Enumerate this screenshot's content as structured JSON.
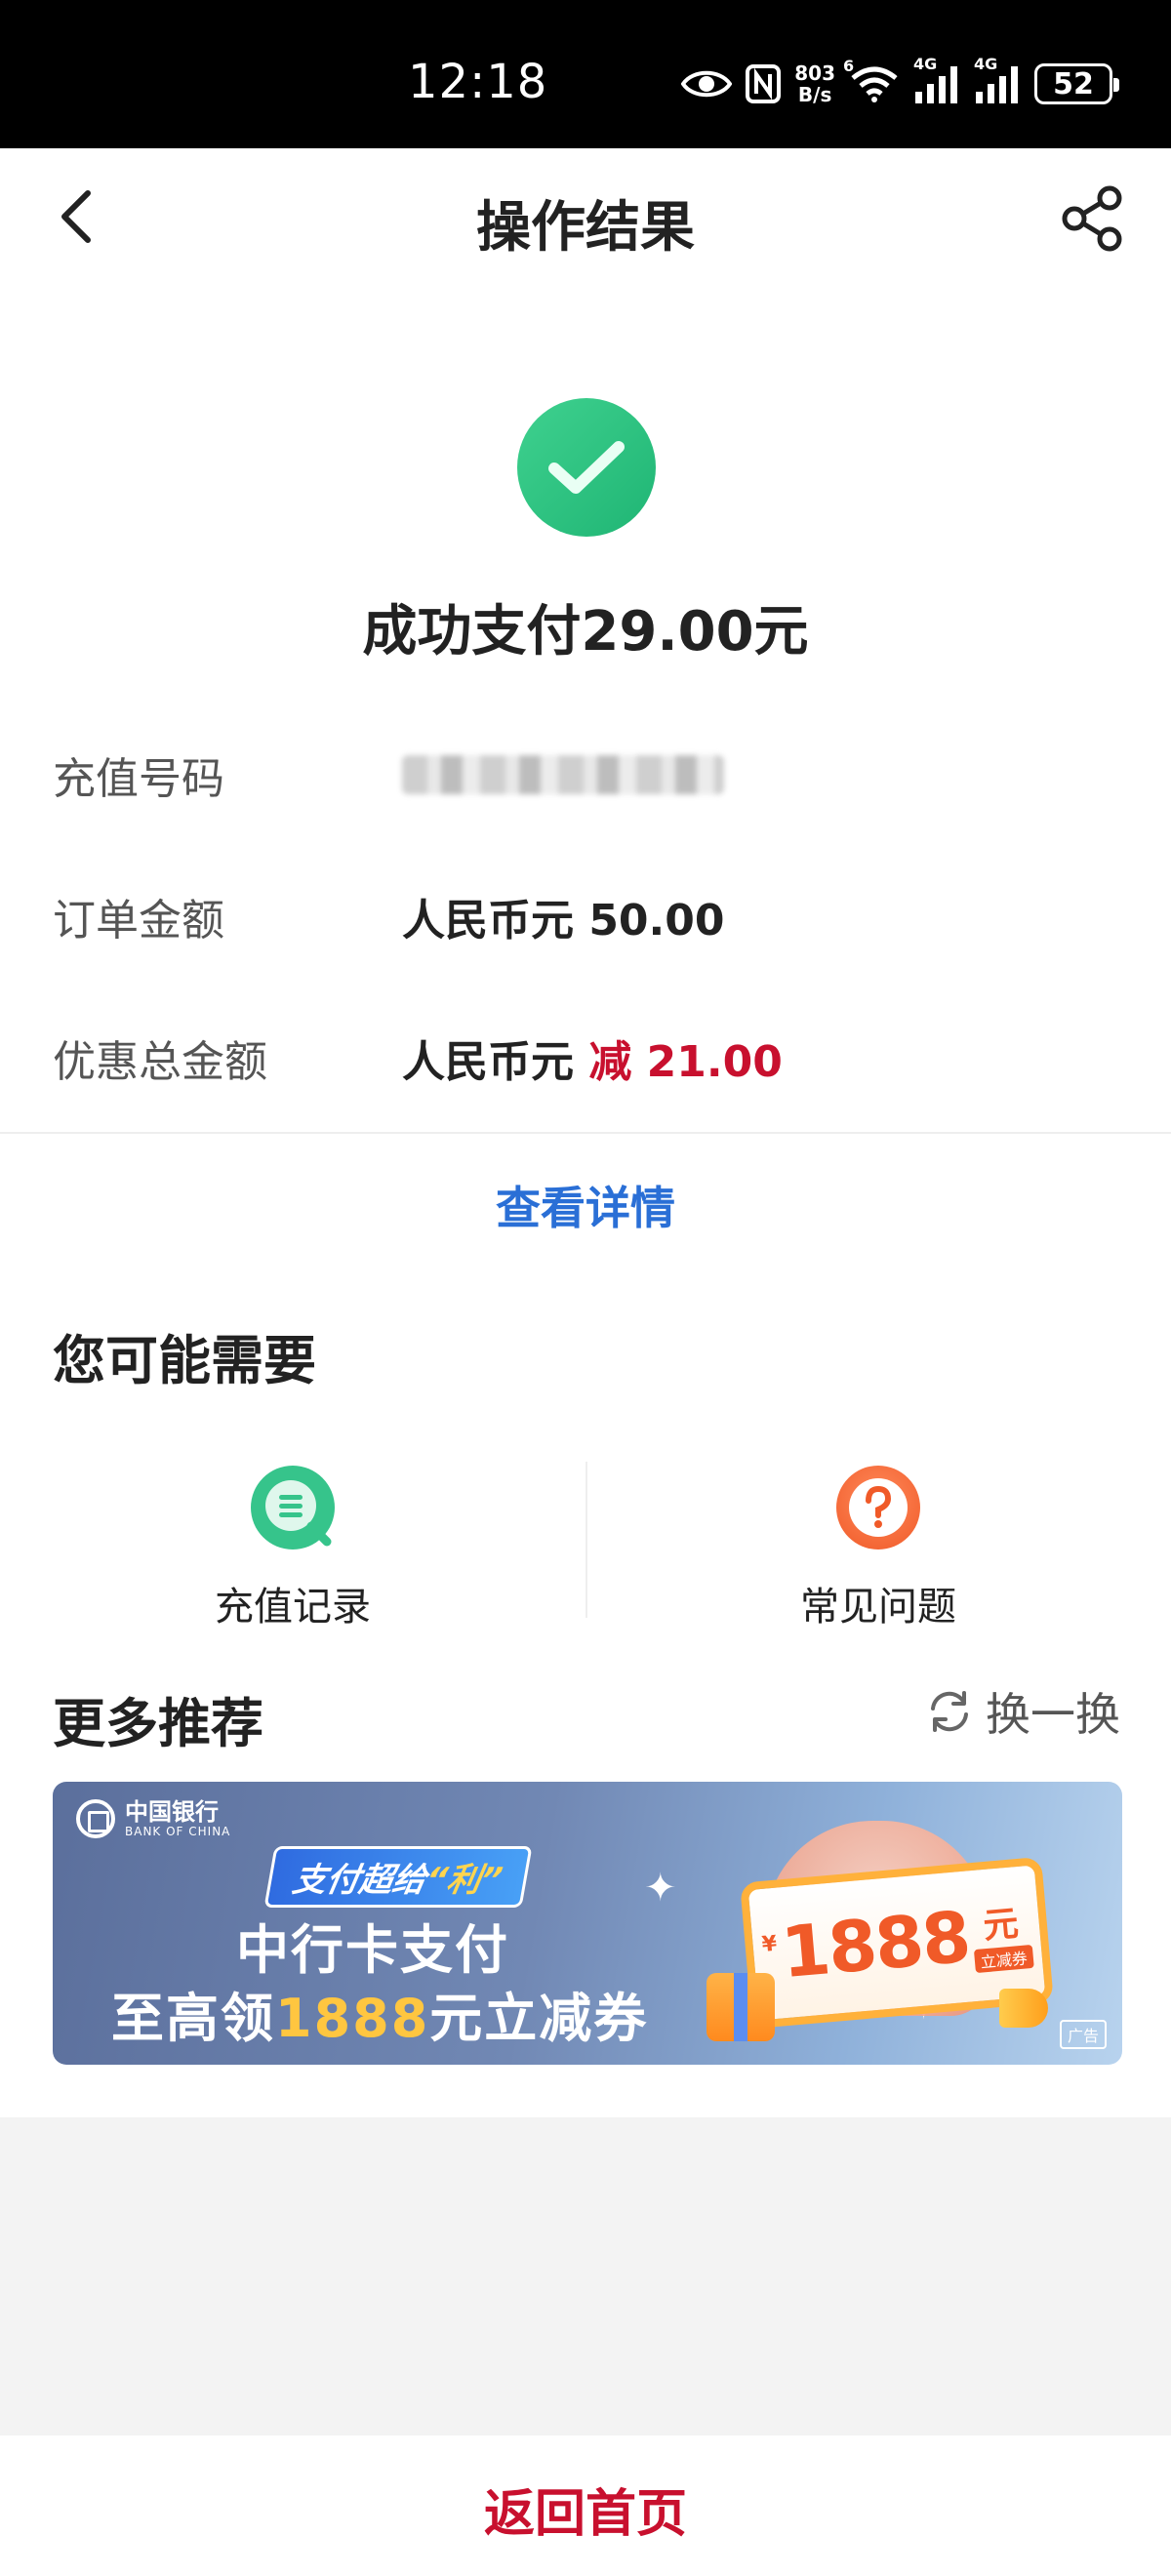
{
  "status_bar": {
    "time": "12:18",
    "net_speed_value": "803",
    "net_speed_unit": "B/s",
    "wifi_label": "6",
    "signal1_label": "4G",
    "signal2_label": "4G",
    "battery": "52"
  },
  "nav": {
    "title": "操作结果"
  },
  "result": {
    "title": "成功支付29.00元",
    "status_color": "#2bc37f",
    "rows": [
      {
        "label": "充值号码",
        "value": ""
      },
      {
        "label": "订单金额",
        "value": "人民币元 50.00"
      },
      {
        "label": "优惠总金额",
        "value_prefix": "人民币元 ",
        "value_discount": "减 21.00"
      }
    ],
    "details_link": "查看详情"
  },
  "need": {
    "title": "您可能需要",
    "items": [
      {
        "label": "充值记录",
        "icon": "search-list-icon",
        "color": "#36c48b"
      },
      {
        "label": "常见问题",
        "icon": "question-icon",
        "color": "#f26b3a"
      }
    ]
  },
  "more": {
    "title": "更多推荐",
    "refresh_label": "换一换",
    "banner": {
      "bank_name_cn": "中国银行",
      "bank_name_en": "BANK OF CHINA",
      "tag_prefix": "支付超给",
      "tag_highlight": "“利”",
      "line1": "中行卡支付",
      "line2_prefix": "至高领",
      "line2_amount": "1888",
      "line2_suffix": "元立减券",
      "coupon_currency": "¥",
      "coupon_amount": "1888",
      "coupon_unit": "元",
      "coupon_sub": "立减券",
      "ad_label": "广告"
    }
  },
  "bottom": {
    "home_label": "返回首页"
  },
  "colors": {
    "accent_blue": "#2a6fd6",
    "accent_red": "#c8102e"
  }
}
